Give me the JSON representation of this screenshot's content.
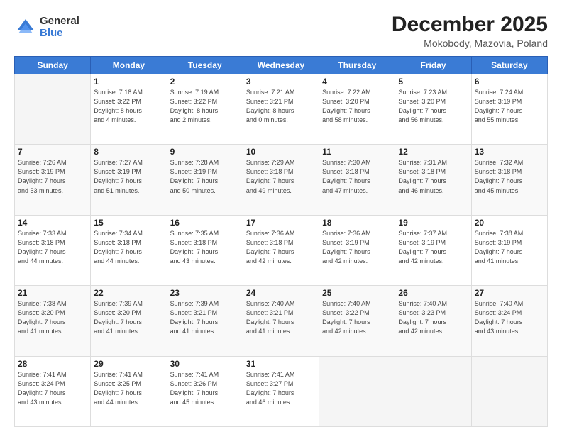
{
  "logo": {
    "general": "General",
    "blue": "Blue"
  },
  "title": "December 2025",
  "location": "Mokobody, Mazovia, Poland",
  "days_of_week": [
    "Sunday",
    "Monday",
    "Tuesday",
    "Wednesday",
    "Thursday",
    "Friday",
    "Saturday"
  ],
  "weeks": [
    [
      {
        "day": "",
        "detail": ""
      },
      {
        "day": "1",
        "detail": "Sunrise: 7:18 AM\nSunset: 3:22 PM\nDaylight: 8 hours\nand 4 minutes."
      },
      {
        "day": "2",
        "detail": "Sunrise: 7:19 AM\nSunset: 3:22 PM\nDaylight: 8 hours\nand 2 minutes."
      },
      {
        "day": "3",
        "detail": "Sunrise: 7:21 AM\nSunset: 3:21 PM\nDaylight: 8 hours\nand 0 minutes."
      },
      {
        "day": "4",
        "detail": "Sunrise: 7:22 AM\nSunset: 3:20 PM\nDaylight: 7 hours\nand 58 minutes."
      },
      {
        "day": "5",
        "detail": "Sunrise: 7:23 AM\nSunset: 3:20 PM\nDaylight: 7 hours\nand 56 minutes."
      },
      {
        "day": "6",
        "detail": "Sunrise: 7:24 AM\nSunset: 3:19 PM\nDaylight: 7 hours\nand 55 minutes."
      }
    ],
    [
      {
        "day": "7",
        "detail": "Sunrise: 7:26 AM\nSunset: 3:19 PM\nDaylight: 7 hours\nand 53 minutes."
      },
      {
        "day": "8",
        "detail": "Sunrise: 7:27 AM\nSunset: 3:19 PM\nDaylight: 7 hours\nand 51 minutes."
      },
      {
        "day": "9",
        "detail": "Sunrise: 7:28 AM\nSunset: 3:19 PM\nDaylight: 7 hours\nand 50 minutes."
      },
      {
        "day": "10",
        "detail": "Sunrise: 7:29 AM\nSunset: 3:18 PM\nDaylight: 7 hours\nand 49 minutes."
      },
      {
        "day": "11",
        "detail": "Sunrise: 7:30 AM\nSunset: 3:18 PM\nDaylight: 7 hours\nand 47 minutes."
      },
      {
        "day": "12",
        "detail": "Sunrise: 7:31 AM\nSunset: 3:18 PM\nDaylight: 7 hours\nand 46 minutes."
      },
      {
        "day": "13",
        "detail": "Sunrise: 7:32 AM\nSunset: 3:18 PM\nDaylight: 7 hours\nand 45 minutes."
      }
    ],
    [
      {
        "day": "14",
        "detail": "Sunrise: 7:33 AM\nSunset: 3:18 PM\nDaylight: 7 hours\nand 44 minutes."
      },
      {
        "day": "15",
        "detail": "Sunrise: 7:34 AM\nSunset: 3:18 PM\nDaylight: 7 hours\nand 44 minutes."
      },
      {
        "day": "16",
        "detail": "Sunrise: 7:35 AM\nSunset: 3:18 PM\nDaylight: 7 hours\nand 43 minutes."
      },
      {
        "day": "17",
        "detail": "Sunrise: 7:36 AM\nSunset: 3:18 PM\nDaylight: 7 hours\nand 42 minutes."
      },
      {
        "day": "18",
        "detail": "Sunrise: 7:36 AM\nSunset: 3:19 PM\nDaylight: 7 hours\nand 42 minutes."
      },
      {
        "day": "19",
        "detail": "Sunrise: 7:37 AM\nSunset: 3:19 PM\nDaylight: 7 hours\nand 42 minutes."
      },
      {
        "day": "20",
        "detail": "Sunrise: 7:38 AM\nSunset: 3:19 PM\nDaylight: 7 hours\nand 41 minutes."
      }
    ],
    [
      {
        "day": "21",
        "detail": "Sunrise: 7:38 AM\nSunset: 3:20 PM\nDaylight: 7 hours\nand 41 minutes."
      },
      {
        "day": "22",
        "detail": "Sunrise: 7:39 AM\nSunset: 3:20 PM\nDaylight: 7 hours\nand 41 minutes."
      },
      {
        "day": "23",
        "detail": "Sunrise: 7:39 AM\nSunset: 3:21 PM\nDaylight: 7 hours\nand 41 minutes."
      },
      {
        "day": "24",
        "detail": "Sunrise: 7:40 AM\nSunset: 3:21 PM\nDaylight: 7 hours\nand 41 minutes."
      },
      {
        "day": "25",
        "detail": "Sunrise: 7:40 AM\nSunset: 3:22 PM\nDaylight: 7 hours\nand 42 minutes."
      },
      {
        "day": "26",
        "detail": "Sunrise: 7:40 AM\nSunset: 3:23 PM\nDaylight: 7 hours\nand 42 minutes."
      },
      {
        "day": "27",
        "detail": "Sunrise: 7:40 AM\nSunset: 3:24 PM\nDaylight: 7 hours\nand 43 minutes."
      }
    ],
    [
      {
        "day": "28",
        "detail": "Sunrise: 7:41 AM\nSunset: 3:24 PM\nDaylight: 7 hours\nand 43 minutes."
      },
      {
        "day": "29",
        "detail": "Sunrise: 7:41 AM\nSunset: 3:25 PM\nDaylight: 7 hours\nand 44 minutes."
      },
      {
        "day": "30",
        "detail": "Sunrise: 7:41 AM\nSunset: 3:26 PM\nDaylight: 7 hours\nand 45 minutes."
      },
      {
        "day": "31",
        "detail": "Sunrise: 7:41 AM\nSunset: 3:27 PM\nDaylight: 7 hours\nand 46 minutes."
      },
      {
        "day": "",
        "detail": ""
      },
      {
        "day": "",
        "detail": ""
      },
      {
        "day": "",
        "detail": ""
      }
    ]
  ]
}
